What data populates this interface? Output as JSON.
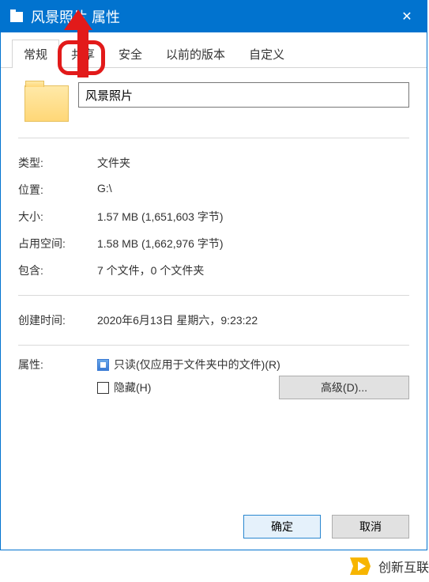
{
  "title": "风景照片 属性",
  "tabs": {
    "general": "常规",
    "share": "共享",
    "security": "安全",
    "previous": "以前的版本",
    "custom": "自定义"
  },
  "folder_name": "风景照片",
  "labels": {
    "type": "类型:",
    "location": "位置:",
    "size": "大小:",
    "size_on_disk": "占用空间:",
    "contains": "包含:",
    "created": "创建时间:",
    "attributes": "属性:"
  },
  "values": {
    "type": "文件夹",
    "location": "G:\\",
    "size": "1.57 MB (1,651,603 字节)",
    "size_on_disk": "1.58 MB (1,662,976 字节)",
    "contains": "7 个文件，0 个文件夹",
    "created": "2020年6月13日 星期六，9:23:22"
  },
  "attributes": {
    "readonly": "只读(仅应用于文件夹中的文件)(R)",
    "hidden": "隐藏(H)",
    "advanced": "高级(D)..."
  },
  "buttons": {
    "ok": "确定",
    "cancel": "取消"
  },
  "watermark": "创新互联"
}
